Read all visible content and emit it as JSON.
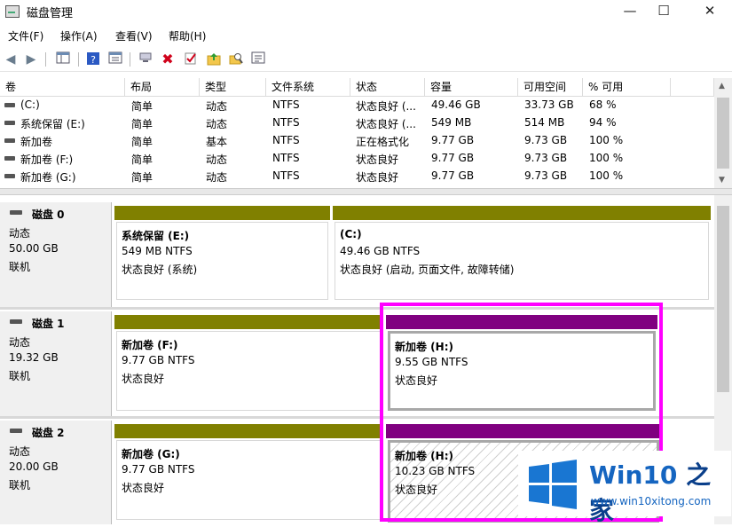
{
  "window": {
    "title": "磁盘管理",
    "minimize": "—",
    "maximize": "☐",
    "close": "✕"
  },
  "menu": [
    "文件(F)",
    "操作(A)",
    "查看(V)",
    "帮助(H)"
  ],
  "toolbar": [
    "back-icon",
    "forward-icon",
    "console-tree-icon",
    "help-icon",
    "properties-icon",
    "connect-icon",
    "delete-icon",
    "check-icon",
    "folder-up-icon",
    "search-folder-icon",
    "list-icon"
  ],
  "volume_table": {
    "columns": [
      "卷",
      "布局",
      "类型",
      "文件系统",
      "状态",
      "容量",
      "可用空间",
      "% 可用"
    ],
    "rows": [
      [
        "(C:)",
        "简单",
        "动态",
        "NTFS",
        "状态良好 (...",
        "49.46 GB",
        "33.73 GB",
        "68 %"
      ],
      [
        "系统保留 (E:)",
        "简单",
        "动态",
        "NTFS",
        "状态良好 (...",
        "549 MB",
        "514 MB",
        "94 %"
      ],
      [
        "新加卷",
        "简单",
        "基本",
        "NTFS",
        "正在格式化",
        "9.77 GB",
        "9.73 GB",
        "100 %"
      ],
      [
        "新加卷 (F:)",
        "简单",
        "动态",
        "NTFS",
        "状态良好",
        "9.77 GB",
        "9.73 GB",
        "100 %"
      ],
      [
        "新加卷 (G:)",
        "简单",
        "动态",
        "NTFS",
        "状态良好",
        "9.77 GB",
        "9.73 GB",
        "100 %"
      ]
    ]
  },
  "disks": [
    {
      "name": "磁盘 0",
      "type": "动态",
      "size": "50.00 GB",
      "status": "联机",
      "partitions": [
        {
          "name": "系统保留  (E:)",
          "size": "549 MB NTFS",
          "status": "状态良好 (系统)"
        },
        {
          "name": "(C:)",
          "size": "49.46 GB NTFS",
          "status": "状态良好 (启动, 页面文件, 故障转储)"
        }
      ]
    },
    {
      "name": "磁盘 1",
      "type": "动态",
      "size": "19.32 GB",
      "status": "联机",
      "partitions": [
        {
          "name": "新加卷  (F:)",
          "size": "9.77 GB NTFS",
          "status": "状态良好"
        },
        {
          "name": "新加卷  (H:)",
          "size": "9.55 GB NTFS",
          "status": "状态良好"
        }
      ]
    },
    {
      "name": "磁盘 2",
      "type": "动态",
      "size": "20.00 GB",
      "status": "联机",
      "partitions": [
        {
          "name": "新加卷  (G:)",
          "size": "9.77 GB NTFS",
          "status": "状态良好"
        },
        {
          "name": "新加卷  (H:)",
          "size": "10.23 GB NTFS",
          "status": "状态良好"
        }
      ]
    }
  ],
  "colors": {
    "simple_volume": "#808000",
    "spanned_volume": "#800080",
    "highlight": "#ff00ff"
  },
  "watermark": {
    "brand": "Win10",
    "brand_suffix": "之家",
    "url": "www.win10xitong.com"
  }
}
